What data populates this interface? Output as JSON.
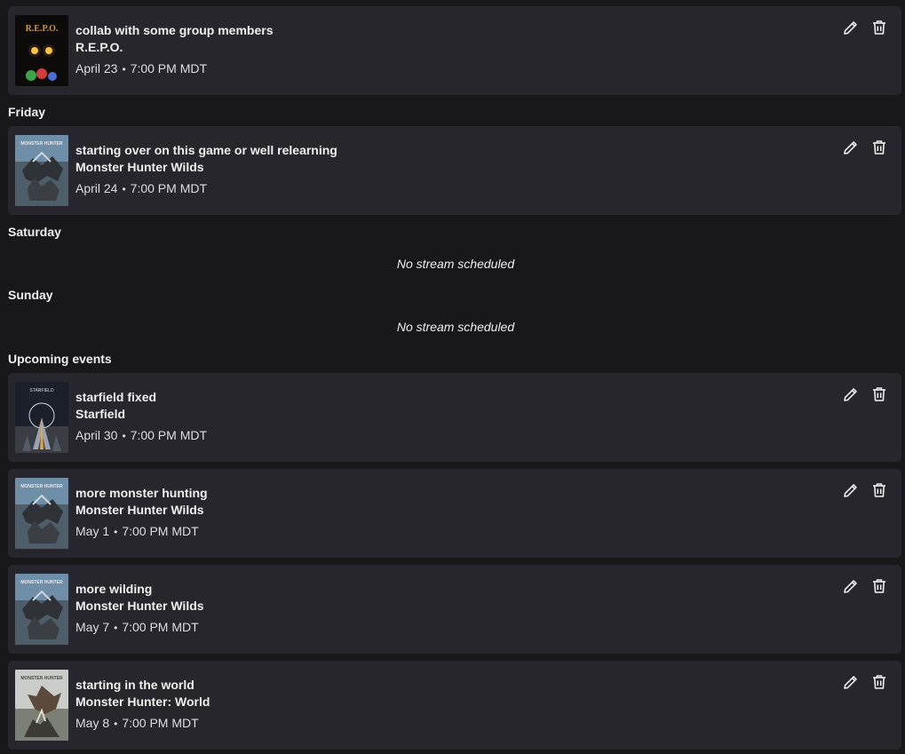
{
  "cards": [
    {
      "title": "collab with some group members",
      "game": "R.E.P.O.",
      "date": "April 23",
      "time": "7:00 PM MDT",
      "art": "repo"
    },
    {
      "title": "starting over on this game or well relearning",
      "game": "Monster Hunter Wilds",
      "date": "April 24",
      "time": "7:00 PM MDT",
      "art": "wilds"
    },
    {
      "title": "starfield fixed",
      "game": "Starfield",
      "date": "April 30",
      "time": "7:00 PM MDT",
      "art": "starfield"
    },
    {
      "title": "more monster hunting",
      "game": "Monster Hunter Wilds",
      "date": "May 1",
      "time": "7:00 PM MDT",
      "art": "wilds"
    },
    {
      "title": "more wilding",
      "game": "Monster Hunter Wilds",
      "date": "May 7",
      "time": "7:00 PM MDT",
      "art": "wilds"
    },
    {
      "title": "starting in the world",
      "game": "Monster Hunter: World",
      "date": "May 8",
      "time": "7:00 PM MDT",
      "art": "world"
    }
  ],
  "sections": {
    "friday": "Friday",
    "saturday": "Saturday",
    "sunday": "Sunday",
    "upcoming": "Upcoming events"
  },
  "empty_text": "No stream scheduled",
  "separator": "•",
  "boxart_text": {
    "repo": "R.E.P.O.",
    "starfield": "STARFIELD",
    "monster_hunter": "MONSTER HUNTER"
  },
  "icons": {
    "edit": "pencil-icon",
    "delete": "trash-icon"
  },
  "colors": {
    "background": "#18181b",
    "card": "#26262c",
    "text": "#efeff1"
  }
}
